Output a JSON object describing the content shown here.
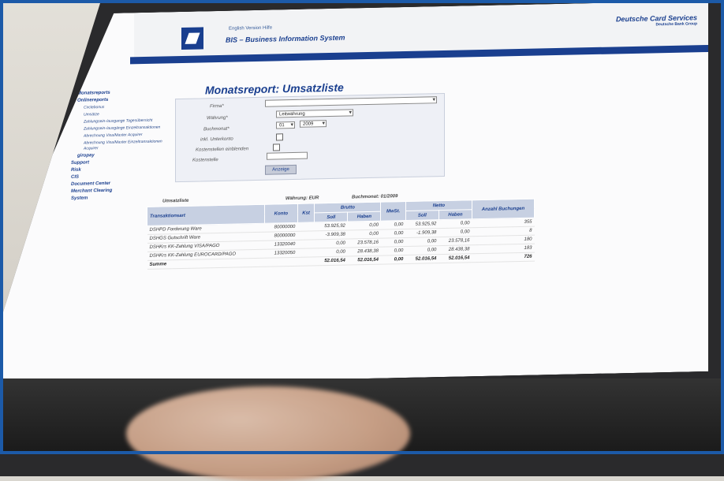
{
  "header": {
    "links": "English Version   Hilfe",
    "system_title": "BIS – Business Information System",
    "brand_name": "Deutsche Card Services",
    "brand_sub": "Deutsche Bank Group"
  },
  "nav": {
    "items": [
      {
        "label": "Monatsreports",
        "level": "mid"
      },
      {
        "label": "Onlinereports",
        "level": "mid"
      },
      {
        "label": "Circlebonus",
        "level": "sub"
      },
      {
        "label": "Umsätze",
        "level": "sub"
      },
      {
        "label": "Zahlungsein-/ausgange Tagesübersicht",
        "level": "sub"
      },
      {
        "label": "Zahlungsein-/ausgänge Einzeltransaktionen",
        "level": "sub"
      },
      {
        "label": "Abrechnung Visa/Master Acquirer",
        "level": "sub"
      },
      {
        "label": "Abrechnung Visa/Master Einzeltransaktionen Acquirer",
        "level": "sub"
      },
      {
        "label": "giropay",
        "level": "mid"
      },
      {
        "label": "Support",
        "level": "top"
      },
      {
        "label": "Risk",
        "level": "top"
      },
      {
        "label": "CIS",
        "level": "top"
      },
      {
        "label": "Document Center",
        "level": "top"
      },
      {
        "label": "Merchant Clearing",
        "level": "top"
      },
      {
        "label": "System",
        "level": "top"
      }
    ]
  },
  "page_title": "Monatsreport: Umsatzliste",
  "form": {
    "firma_label": "Firma*",
    "waehrung_label": "Währung*",
    "waehrung_value": "Leitwährung",
    "buchmonat_label": "Buchmonat*",
    "month_value": "01",
    "year_value": "2009",
    "unterkonto_label": "inkl. Unterkonto",
    "kostenstellen_label": "Kostenstellen einblenden",
    "kostenstelle_label": "Kostenstelle",
    "submit_label": "Anzeige"
  },
  "summary": {
    "title": "Umsatzliste",
    "currency": "Währung: EUR",
    "month": "Buchmonat: 01/2009"
  },
  "table": {
    "headers": {
      "transaktionsart": "Transaktionsart",
      "konto": "Konto",
      "kst": "Kst",
      "brutto": "Brutto",
      "mwst": "MwSt.",
      "netto": "Netto",
      "anzahl": "Anzahl Buchungen",
      "soll": "Soll",
      "haben": "Haben"
    },
    "rows": [
      {
        "art": "DSHPD Forderung Ware",
        "konto": "80000000",
        "b_soll": "53.925,92",
        "b_haben": "0,00",
        "mwst": "0,00",
        "n_soll": "53.925,92",
        "n_haben": "0,00",
        "anzahl": "355"
      },
      {
        "art": "DSHGS Gutschrift Ware",
        "konto": "80000000",
        "b_soll": "-3.909,38",
        "b_haben": "0,00",
        "mwst": "0,00",
        "n_soll": "-1.909,38",
        "n_haben": "0,00",
        "anzahl": "8"
      },
      {
        "art": "DSHKrs KK-Zahlung VISA/PAGO",
        "konto": "13320040",
        "b_soll": "0,00",
        "b_haben": "23.578,16",
        "mwst": "0,00",
        "n_soll": "0,00",
        "n_haben": "23.578,16",
        "anzahl": "180"
      },
      {
        "art": "DSHKrs KK-Zahlung EUROCARD/PAGO",
        "konto": "13320050",
        "b_soll": "0,00",
        "b_haben": "28.438,38",
        "mwst": "0,00",
        "n_soll": "0,00",
        "n_haben": "28.438,38",
        "anzahl": "183"
      }
    ],
    "sum": {
      "label": "Summe",
      "b_soll": "52.016,54",
      "b_haben": "52.016,54",
      "mwst": "0,00",
      "n_soll": "52.016,54",
      "n_haben": "52.016,54",
      "anzahl": "726"
    }
  }
}
